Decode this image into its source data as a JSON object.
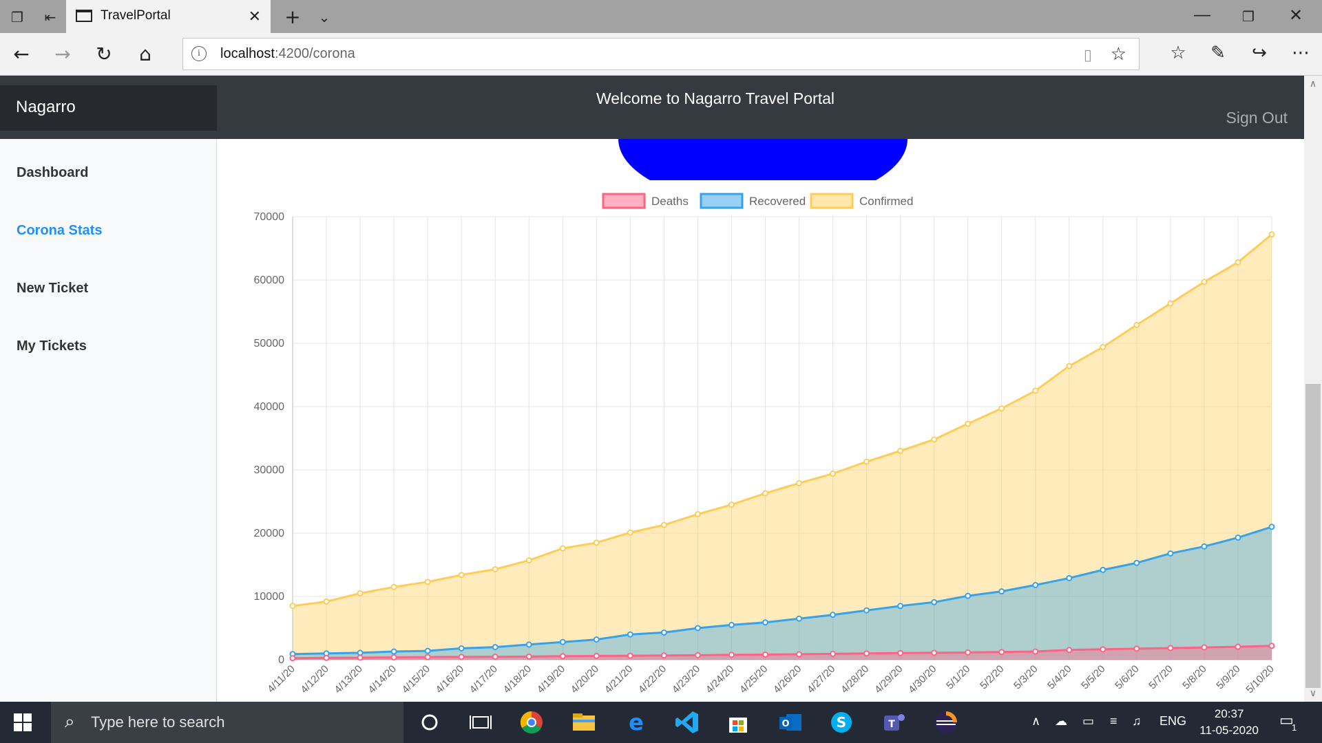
{
  "browser": {
    "tab_title": "TravelPortal",
    "url_host": "localhost",
    "url_rest": ":4200/corona"
  },
  "header": {
    "brand": "Nagarro",
    "welcome": "Welcome to Nagarro Travel Portal",
    "signout": "Sign Out"
  },
  "sidebar": {
    "items": [
      {
        "label": "Dashboard",
        "active": false
      },
      {
        "label": "Corona Stats",
        "active": true
      },
      {
        "label": "New Ticket",
        "active": false
      },
      {
        "label": "My Tickets",
        "active": false
      }
    ]
  },
  "taskbar": {
    "search_placeholder": "Type here to search",
    "lang": "ENG",
    "time": "20:37",
    "date": "11-05-2020",
    "notification_count": "1"
  },
  "colors": {
    "deaths": "#ff6384",
    "recovered": "#36a2eb",
    "confirmed": "#ffcd56",
    "pie_blue": "#0000ff"
  },
  "chart_data": {
    "type": "area",
    "x": [
      "4/11/20",
      "4/12/20",
      "4/13/20",
      "4/14/20",
      "4/15/20",
      "4/16/20",
      "4/17/20",
      "4/18/20",
      "4/19/20",
      "4/20/20",
      "4/21/20",
      "4/22/20",
      "4/23/20",
      "4/24/20",
      "4/25/20",
      "4/26/20",
      "4/27/20",
      "4/28/20",
      "4/29/20",
      "4/30/20",
      "5/1/20",
      "5/2/20",
      "5/3/20",
      "5/4/20",
      "5/5/20",
      "5/6/20",
      "5/7/20",
      "5/8/20",
      "5/9/20",
      "5/10/20"
    ],
    "series": [
      {
        "name": "Deaths",
        "values": [
          250,
          290,
          330,
          380,
          420,
          450,
          480,
          500,
          560,
          600,
          640,
          680,
          720,
          780,
          820,
          870,
          930,
          1000,
          1050,
          1100,
          1150,
          1220,
          1300,
          1550,
          1650,
          1750,
          1850,
          1950,
          2050,
          2200
        ]
      },
      {
        "name": "Recovered",
        "values": [
          900,
          1000,
          1100,
          1300,
          1400,
          1800,
          2000,
          2400,
          2800,
          3200,
          4000,
          4300,
          5000,
          5500,
          5900,
          6500,
          7100,
          7800,
          8500,
          9100,
          10100,
          10800,
          11800,
          12900,
          14200,
          15300,
          16800,
          17900,
          19300,
          21000
        ]
      },
      {
        "name": "Confirmed",
        "values": [
          8500,
          9200,
          10500,
          11500,
          12300,
          13400,
          14300,
          15700,
          17600,
          18500,
          20100,
          21300,
          23000,
          24500,
          26300,
          27900,
          29400,
          31300,
          33000,
          34800,
          37300,
          39700,
          42500,
          46400,
          49400,
          52900,
          56300,
          59700,
          62800,
          67200
        ]
      }
    ],
    "ylim": [
      0,
      70000
    ],
    "yticks": [
      0,
      10000,
      20000,
      30000,
      40000,
      50000,
      60000,
      70000
    ],
    "grid": true,
    "legend_position": "top"
  }
}
